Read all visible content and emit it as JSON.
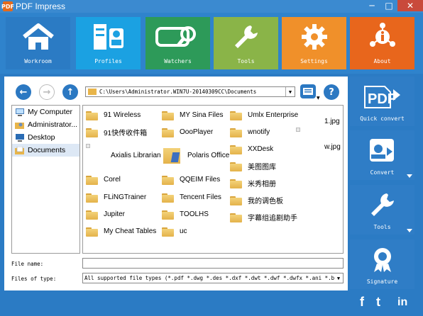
{
  "window": {
    "title": "PDF Impress",
    "minimize": "─",
    "maximize": "□",
    "close": "✕",
    "app_icon_text": "PDF"
  },
  "nav": [
    {
      "label": "Workroom",
      "bg": "#2b7bc4",
      "icon": "house-icon"
    },
    {
      "label": "Profiles",
      "bg": "#1ba1e2",
      "icon": "profiles-icon"
    },
    {
      "label": "Watchers",
      "bg": "#2d9a59",
      "icon": "watchers-icon"
    },
    {
      "label": "Tools",
      "bg": "#8ab448",
      "icon": "wrench-icon"
    },
    {
      "label": "Settings",
      "bg": "#f0902a",
      "icon": "gear-icon"
    },
    {
      "label": "About",
      "bg": "#e8661c",
      "icon": "info-icon"
    }
  ],
  "toolbar": {
    "back": "←",
    "forward": "→",
    "up": "↑",
    "help": "?",
    "view_icon": "view-icon"
  },
  "path": "C:\\Users\\Administrator.WIN7U-20140309CC\\Documents",
  "tree": [
    {
      "label": "My Computer",
      "icon": "computer-icon",
      "selected": false
    },
    {
      "label": "Administrator...",
      "icon": "user-folder-icon",
      "selected": false
    },
    {
      "label": "Desktop",
      "icon": "desktop-icon",
      "selected": false
    },
    {
      "label": "Documents",
      "icon": "documents-icon",
      "selected": true
    }
  ],
  "files": [
    {
      "name": "91 Wireless",
      "type": "folder"
    },
    {
      "name": "91快传收件箱",
      "type": "folder"
    },
    {
      "name": "Axialis Librarian",
      "type": "folder"
    },
    {
      "name": "Corel",
      "type": "folder"
    },
    {
      "name": "FLiNGTrainer",
      "type": "folder"
    },
    {
      "name": "Jupiter",
      "type": "folder"
    },
    {
      "name": "My Cheat Tables",
      "type": "folder"
    },
    {
      "name": "MY Sina Files",
      "type": "folder"
    },
    {
      "name": "OooPlayer",
      "type": "folder"
    },
    {
      "name": "Polaris Office",
      "type": "folder"
    },
    {
      "name": "QQEIM Files",
      "type": "folder"
    },
    {
      "name": "Tencent Files",
      "type": "folder"
    },
    {
      "name": "TOOLHS",
      "type": "folder"
    },
    {
      "name": "uc",
      "type": "folder"
    },
    {
      "name": "Umlx Enterprise",
      "type": "folder"
    },
    {
      "name": "wnotify",
      "type": "folder"
    },
    {
      "name": "XXDesk",
      "type": "folder"
    },
    {
      "name": "美图图库",
      "type": "folder"
    },
    {
      "name": "米秀相册",
      "type": "folder"
    },
    {
      "name": "我的调色板",
      "type": "folder"
    },
    {
      "name": "字幕组追剧助手",
      "type": "folder"
    },
    {
      "name": "1.jpg",
      "type": "image"
    },
    {
      "name": "w.jpg",
      "type": "image"
    }
  ],
  "file_name": {
    "label": "File name:",
    "value": ""
  },
  "file_type": {
    "label": "Files of type:",
    "value": "All supported file types (*.pdf *.dwg *.des *.dxf *.dwt *.dwf *.dwfx *.ani *.bmp *."
  },
  "actions": [
    {
      "label": "Quick convert",
      "icon": "pdf-icon",
      "has_menu": false
    },
    {
      "label": "Convert",
      "icon": "convert-icon",
      "has_menu": true
    },
    {
      "label": "Tools",
      "icon": "wrench-icon",
      "has_menu": true
    },
    {
      "label": "Signature",
      "icon": "signature-icon",
      "has_menu": false
    }
  ],
  "social": {
    "facebook": "f",
    "twitter": "t",
    "linkedin": "in"
  }
}
